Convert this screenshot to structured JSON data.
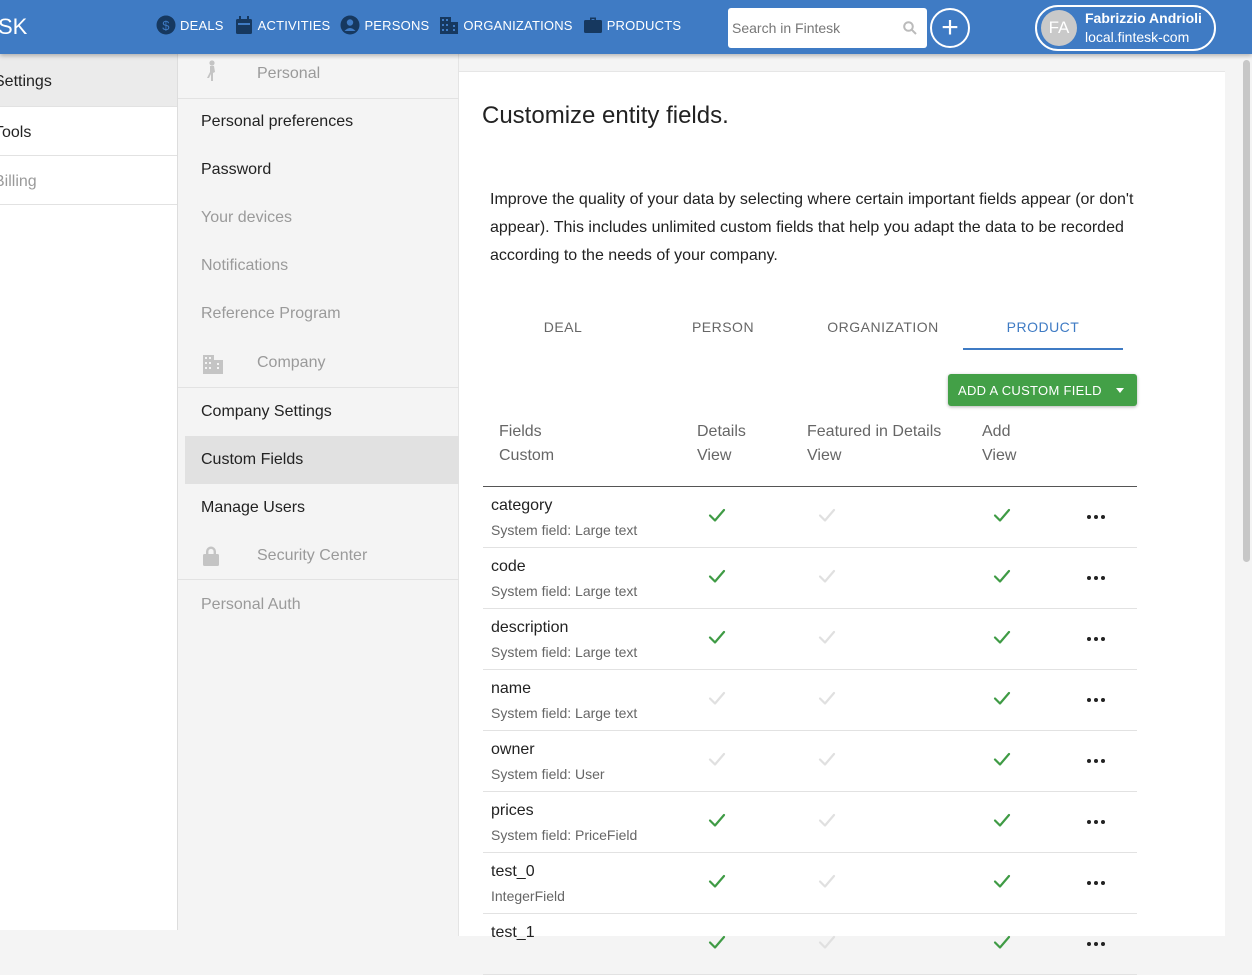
{
  "brand": "SK",
  "nav": [
    {
      "label": "DEALS",
      "icon": "dollar-icon"
    },
    {
      "label": "ACTIVITIES",
      "icon": "calendar-icon"
    },
    {
      "label": "PERSONS",
      "icon": "person-icon"
    },
    {
      "label": "ORGANIZATIONS",
      "icon": "building-icon"
    },
    {
      "label": "PRODUCTS",
      "icon": "briefcase-icon"
    }
  ],
  "search": {
    "placeholder": "Search in Fintesk"
  },
  "user": {
    "initials": "FA",
    "name": "Fabrizzio Andrioli",
    "org": "local.fintesk-com"
  },
  "sidebar": {
    "items": [
      {
        "label": "Settings"
      },
      {
        "label": "Tools"
      },
      {
        "label": "Billing"
      }
    ]
  },
  "menu": {
    "personal_section": "Personal",
    "personal_preferences": "Personal preferences",
    "password": "Password",
    "your_devices": "Your devices",
    "notifications": "Notifications",
    "reference_program": "Reference Program",
    "company_section": "Company",
    "company_settings": "Company Settings",
    "custom_fields": "Custom Fields",
    "manage_users": "Manage Users",
    "security_section": "Security Center",
    "personal_auth": "Personal Auth"
  },
  "main": {
    "title": "Customize entity fields.",
    "intro": "Improve the quality of your data by selecting where certain important fields appear (or don't appear). This includes unlimited custom fields that help you adapt the data to be recorded according to the needs of your company.",
    "tabs": [
      "DEAL",
      "PERSON",
      "ORGANIZATION",
      "PRODUCT"
    ],
    "active_tab": "PRODUCT",
    "add_button": "ADD A CUSTOM FIELD",
    "columns": {
      "fields_line1": "Fields",
      "fields_line2": "Custom",
      "details_line1": "Details",
      "details_line2": "View",
      "featured_line1": "Featured in Details",
      "featured_line2": "View",
      "add_line1": "Add",
      "add_line2": "View"
    },
    "rows": [
      {
        "name": "category",
        "type": "System field: Large text",
        "details": true,
        "featured": false,
        "add": true
      },
      {
        "name": "code",
        "type": "System field: Large text",
        "details": true,
        "featured": false,
        "add": true
      },
      {
        "name": "description",
        "type": "System field: Large text",
        "details": true,
        "featured": false,
        "add": true
      },
      {
        "name": "name",
        "type": "System field: Large text",
        "details": false,
        "featured": false,
        "add": true
      },
      {
        "name": "owner",
        "type": "System field: User",
        "details": false,
        "featured": false,
        "add": true
      },
      {
        "name": "prices",
        "type": "System field: PriceField",
        "details": true,
        "featured": false,
        "add": true
      },
      {
        "name": "test_0",
        "type": "IntegerField",
        "details": true,
        "featured": false,
        "add": true
      },
      {
        "name": "test_1",
        "type": "",
        "details": true,
        "featured": false,
        "add": true
      }
    ]
  },
  "colors": {
    "header": "#3f7bc4",
    "accent_green": "#43a047",
    "check_green": "#3f9b45"
  }
}
